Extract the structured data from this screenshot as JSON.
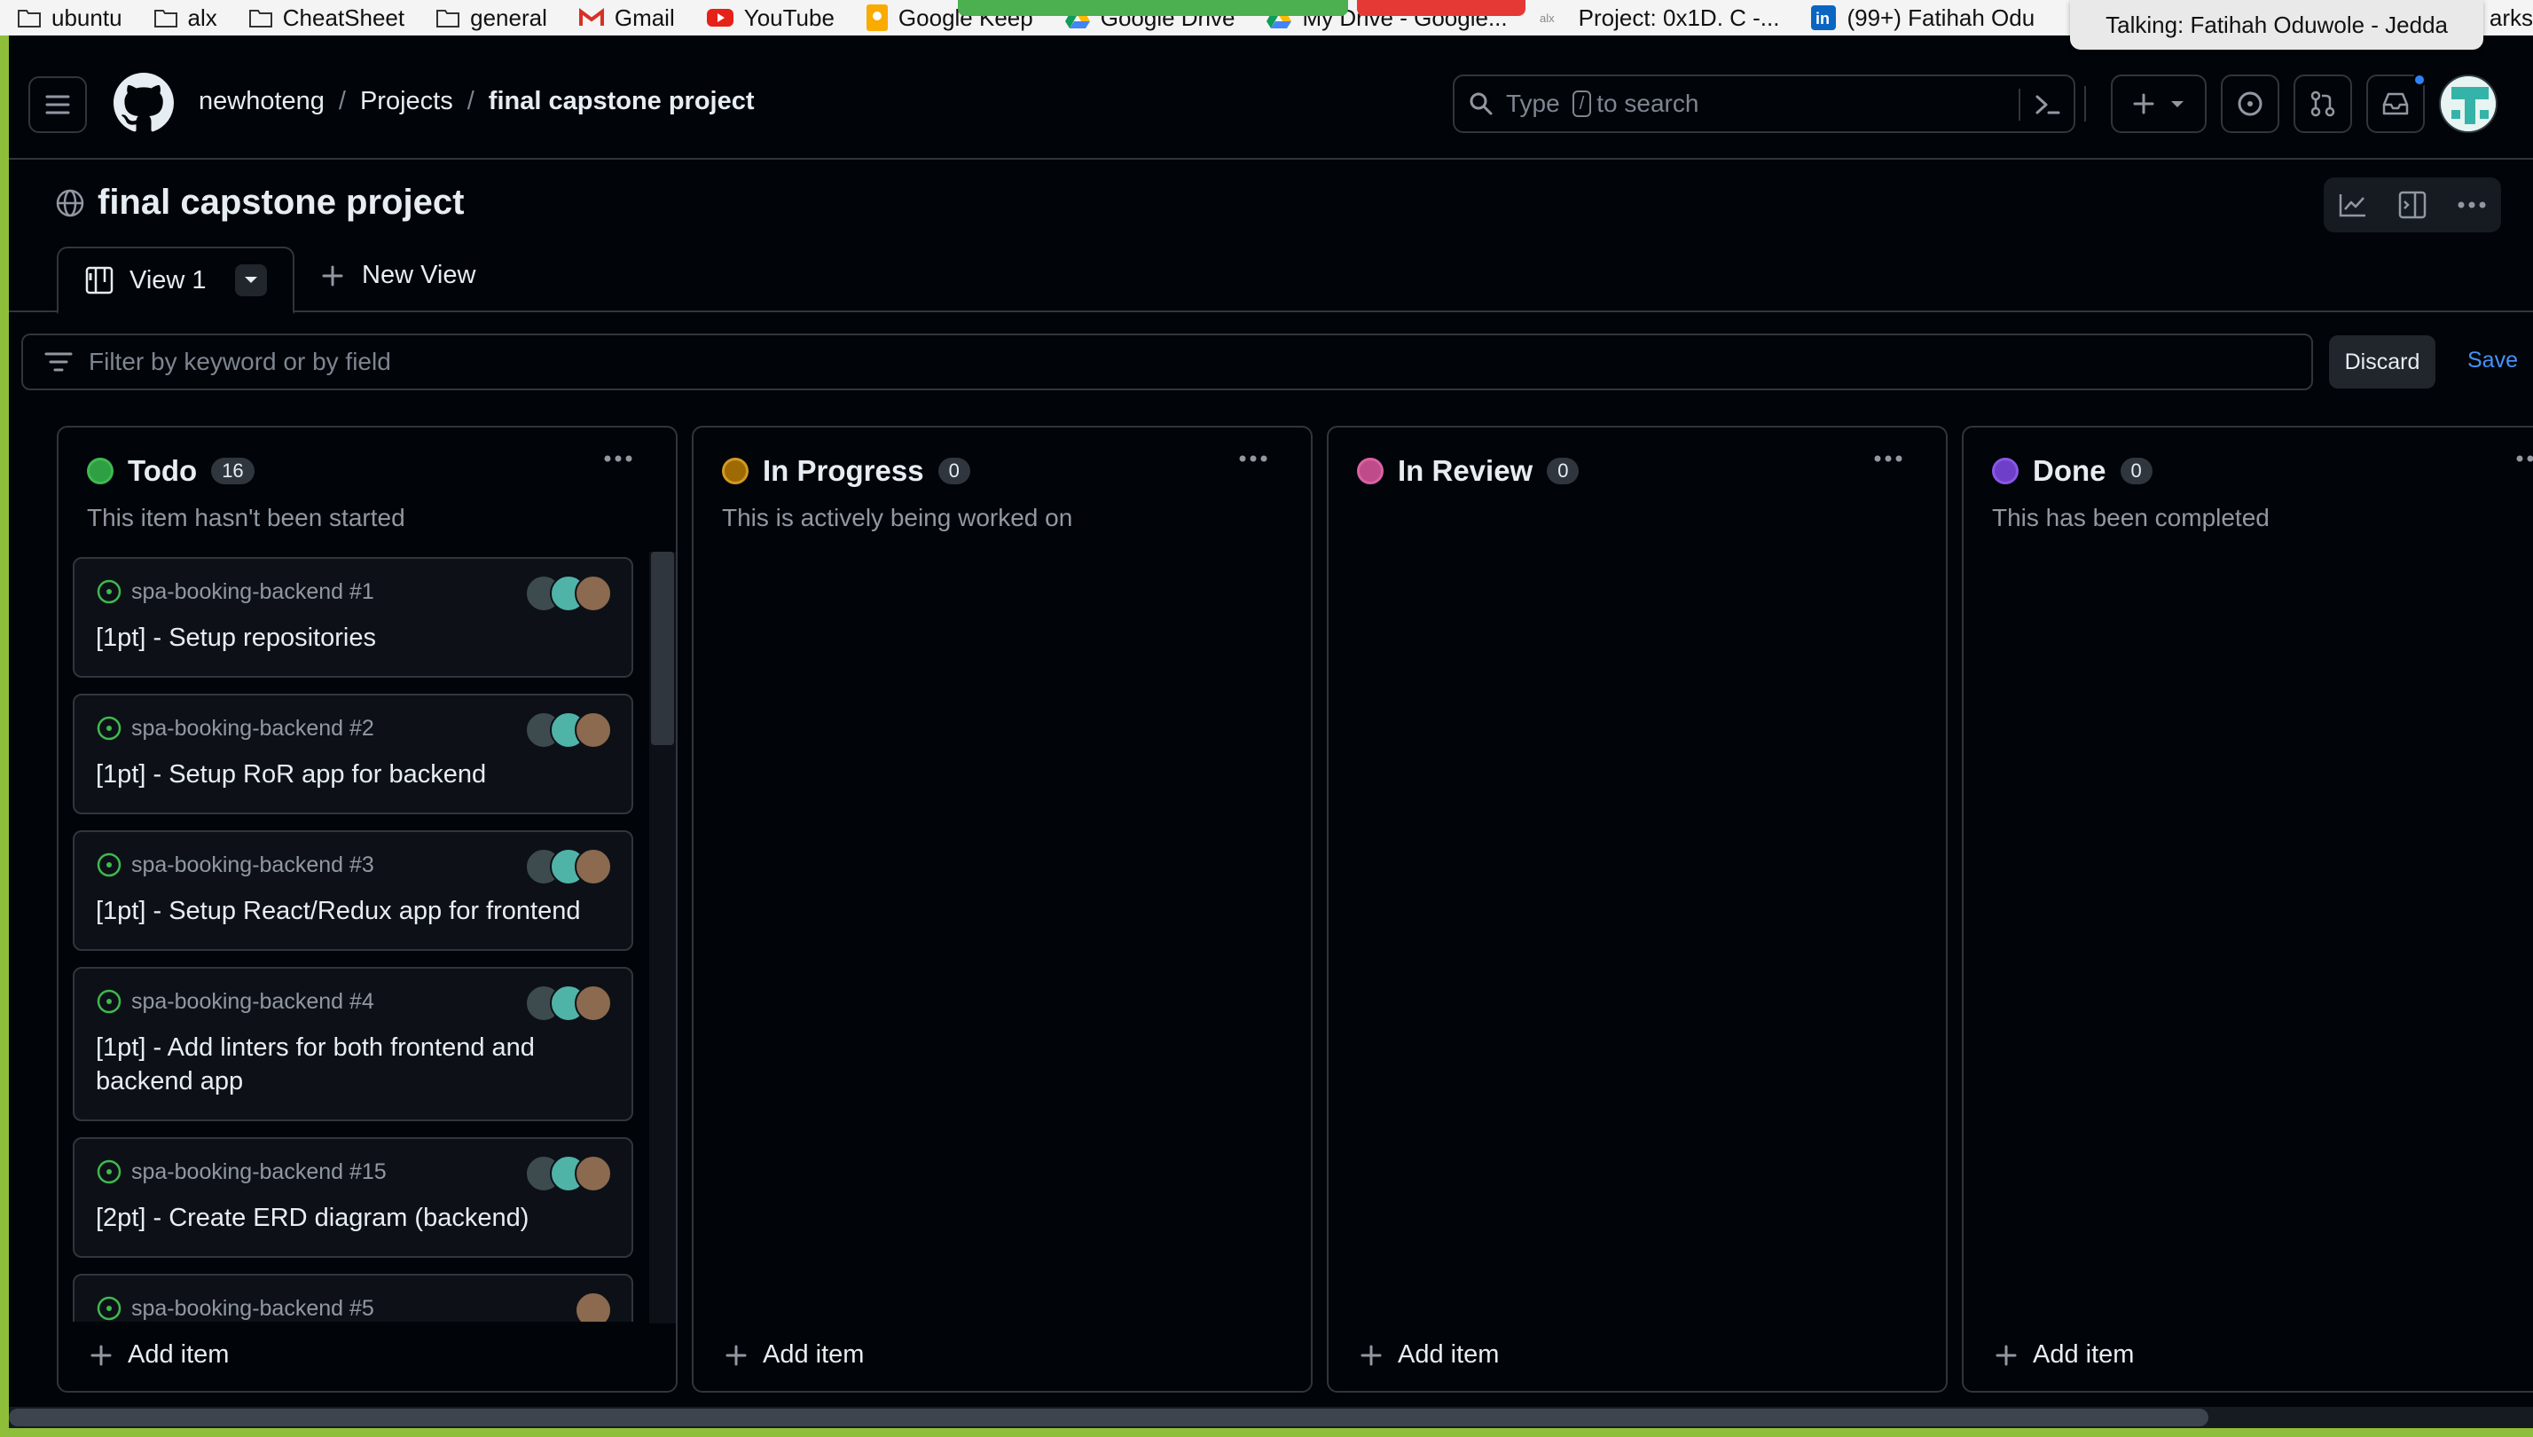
{
  "bookmarks": [
    {
      "label": "ubuntu",
      "icon": "folder-icon"
    },
    {
      "label": "alx",
      "icon": "folder-icon"
    },
    {
      "label": "CheatSheet",
      "icon": "folder-icon"
    },
    {
      "label": "general",
      "icon": "folder-icon"
    },
    {
      "label": "Gmail",
      "icon": "gmail-icon"
    },
    {
      "label": "YouTube",
      "icon": "youtube-icon"
    },
    {
      "label": "Google Keep",
      "icon": "keep-icon"
    },
    {
      "label": "Google Drive",
      "icon": "drive-icon"
    },
    {
      "label": "My Drive - Google...",
      "icon": "drive-icon"
    },
    {
      "label": "Project: 0x1D. C -...",
      "icon": "alx-icon"
    },
    {
      "label": "(99+) Fatihah Odu",
      "icon": "linkedin-icon"
    }
  ],
  "bookmarks_right": "arks",
  "meeting": {
    "talking": "Talking: Fatihah Oduwole - Jedda"
  },
  "breadcrumb": {
    "owner": "newhoteng",
    "section": "Projects",
    "project": "final capstone project"
  },
  "search": {
    "prefix": "Type",
    "key": "/",
    "suffix": "to search"
  },
  "project": {
    "title": "final capstone project"
  },
  "tabs": {
    "active": "View 1",
    "new_view": "New View"
  },
  "filter": {
    "placeholder": "Filter by keyword or by field",
    "discard": "Discard",
    "save": "Save"
  },
  "columns": [
    {
      "name": "Todo",
      "count": "16",
      "color": "#3fb950",
      "fill": "#2ea043",
      "description": "This item hasn't been started",
      "add_item": "Add item",
      "cards": [
        {
          "repo": "spa-booking-backend #1",
          "title": "[1pt] - Setup repositories",
          "assignees": 3
        },
        {
          "repo": "spa-booking-backend #2",
          "title": "[1pt] - Setup RoR app for backend",
          "assignees": 3
        },
        {
          "repo": "spa-booking-backend #3",
          "title": "[1pt] - Setup React/Redux app for frontend",
          "assignees": 3
        },
        {
          "repo": "spa-booking-backend #4",
          "title": "[1pt] - Add linters for both frontend and backend app",
          "assignees": 3
        },
        {
          "repo": "spa-booking-backend #15",
          "title": "[2pt] - Create ERD diagram (backend)",
          "assignees": 3
        },
        {
          "repo": "spa-booking-backend #5",
          "title": "",
          "assignees": 1
        }
      ]
    },
    {
      "name": "In Progress",
      "count": "0",
      "color": "#d29922",
      "fill": "#9e6a03",
      "description": "This is actively being worked on",
      "add_item": "Add item",
      "cards": []
    },
    {
      "name": "In Review",
      "count": "0",
      "color": "#db61a2",
      "fill": "#bf4b8a",
      "description": "",
      "add_item": "Add item",
      "cards": []
    },
    {
      "name": "Done",
      "count": "0",
      "color": "#8957e5",
      "fill": "#6e40c9",
      "description": "This has been completed",
      "add_item": "Add item",
      "cards": []
    }
  ]
}
